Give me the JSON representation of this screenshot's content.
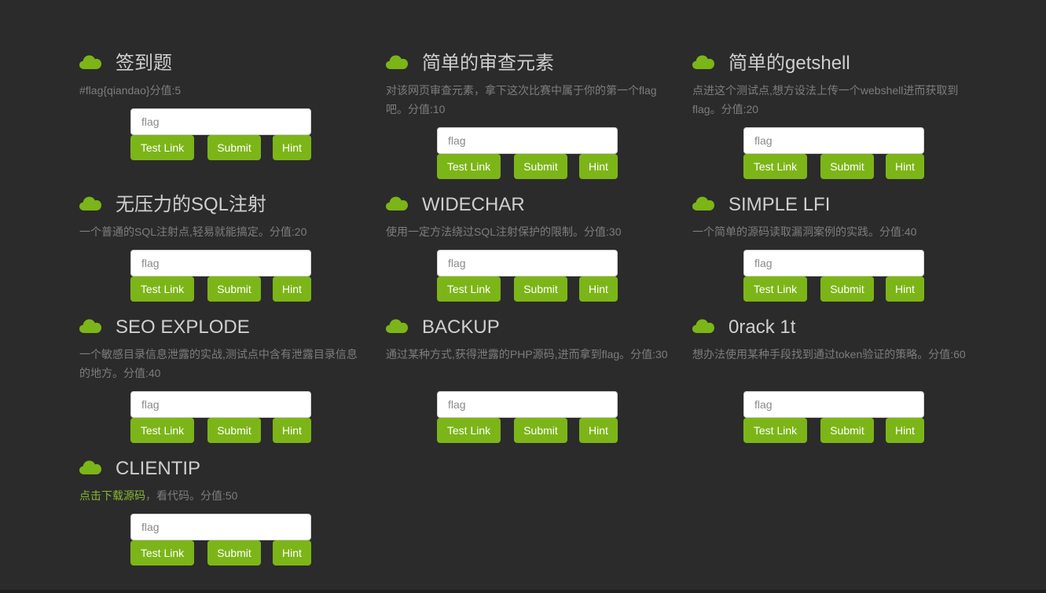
{
  "colors": {
    "background": "#2b2b2b",
    "accent": "#7cb518",
    "title_text": "#cfcfcf",
    "desc_text": "#7d7d7d",
    "link_text": "#86b82f"
  },
  "icon": "cloud-icon",
  "challenges": [
    {
      "title": "签到题",
      "desc": "#flag{qiandao}分值:5",
      "placeholder": "flag",
      "test_label": "Test Link",
      "submit_label": "Submit",
      "hint_label": "Hint"
    },
    {
      "title": "简单的审查元素",
      "desc": "对该网页审查元素，拿下这次比赛中属于你的第一个flag吧。分值:10",
      "placeholder": "flag",
      "test_label": "Test Link",
      "submit_label": "Submit",
      "hint_label": "Hint"
    },
    {
      "title": "简单的getshell",
      "desc": "点进这个测试点,想方设法上传一个webshell进而获取到flag。分值:20",
      "placeholder": "flag",
      "test_label": "Test Link",
      "submit_label": "Submit",
      "hint_label": "Hint"
    },
    {
      "title": "无压力的SQL注射",
      "desc": "一个普通的SQL注射点,轻易就能搞定。分值:20",
      "placeholder": "flag",
      "test_label": "Test Link",
      "submit_label": "Submit",
      "hint_label": "Hint"
    },
    {
      "title": "WIDECHAR",
      "desc": "使用一定方法绕过SQL注射保护的限制。分值:30",
      "placeholder": "flag",
      "test_label": "Test Link",
      "submit_label": "Submit",
      "hint_label": "Hint"
    },
    {
      "title": "SIMPLE LFI",
      "desc": "一个简单的源码读取漏洞案例的实践。分值:40",
      "placeholder": "flag",
      "test_label": "Test Link",
      "submit_label": "Submit",
      "hint_label": "Hint"
    },
    {
      "title": "SEO EXPLODE",
      "desc": "一个敏感目录信息泄露的实战,测试点中含有泄露目录信息的地方。分值:40",
      "placeholder": "flag",
      "test_label": "Test Link",
      "submit_label": "Submit",
      "hint_label": "Hint"
    },
    {
      "title": "BACKUP",
      "desc": "通过某种方式,获得泄露的PHP源码,进而拿到flag。分值:30",
      "placeholder": "flag",
      "test_label": "Test Link",
      "submit_label": "Submit",
      "hint_label": "Hint"
    },
    {
      "title": "0rack 1t",
      "desc": "想办法使用某种手段找到通过token验证的策略。分值:60",
      "placeholder": "flag",
      "test_label": "Test Link",
      "submit_label": "Submit",
      "hint_label": "Hint"
    },
    {
      "title": "CLIENTIP",
      "desc_link": "点击下载源码",
      "desc": "，看代码。分值:50",
      "placeholder": "flag",
      "test_label": "Test Link",
      "submit_label": "Submit",
      "hint_label": "Hint"
    }
  ]
}
